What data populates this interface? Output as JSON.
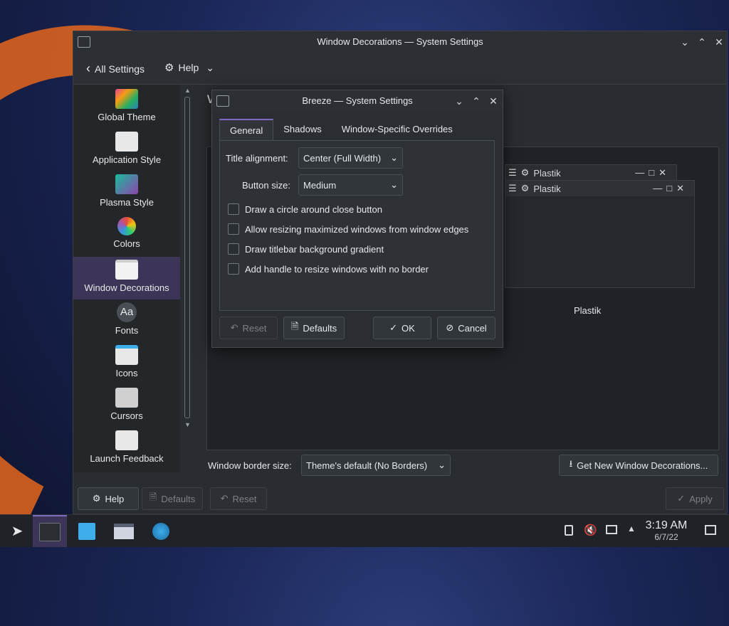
{
  "main_window": {
    "title": "Window Decorations — System Settings",
    "toolbar": {
      "back_label": "All Settings",
      "help_label": "Help"
    },
    "sidebar": [
      {
        "label": "Global Theme"
      },
      {
        "label": "Application Style"
      },
      {
        "label": "Plasma Style"
      },
      {
        "label": "Colors"
      },
      {
        "label": "Window Decorations",
        "active": true
      },
      {
        "label": "Fonts",
        "icon_text": "Aa"
      },
      {
        "label": "Icons"
      },
      {
        "label": "Cursors"
      },
      {
        "label": "Launch Feedback"
      }
    ],
    "preview": {
      "theme_name": "Plastik",
      "caption": "Plastik"
    },
    "border_size_label": "Window border size:",
    "border_size_value": "Theme's default (No Borders)",
    "get_new_label": "Get New Window Decorations...",
    "footer": {
      "help": "Help",
      "defaults": "Defaults",
      "reset": "Reset",
      "apply": "Apply"
    },
    "header_fragment": "W"
  },
  "dialog": {
    "title": "Breeze — System Settings",
    "tabs": [
      "General",
      "Shadows",
      "Window-Specific Overrides"
    ],
    "title_alignment_label": "Title alignment:",
    "title_alignment_value": "Center (Full Width)",
    "button_size_label": "Button size:",
    "button_size_value": "Medium",
    "checkboxes": [
      {
        "label": "Draw a circle around close button",
        "checked": false
      },
      {
        "label": "Allow resizing maximized windows from window edges",
        "checked": false
      },
      {
        "label": "Draw titlebar background gradient",
        "checked": false
      },
      {
        "label": "Add handle to resize windows with no border",
        "checked": false
      }
    ],
    "buttons": {
      "reset": "Reset",
      "defaults": "Defaults",
      "ok": "OK",
      "cancel": "Cancel"
    }
  },
  "taskbar": {
    "time": "3:19 AM",
    "date": "6/7/22"
  },
  "colors": {
    "accent": "#7e6bc4",
    "active_sidebar": "#3d3557",
    "window_bg": "#292c30"
  }
}
